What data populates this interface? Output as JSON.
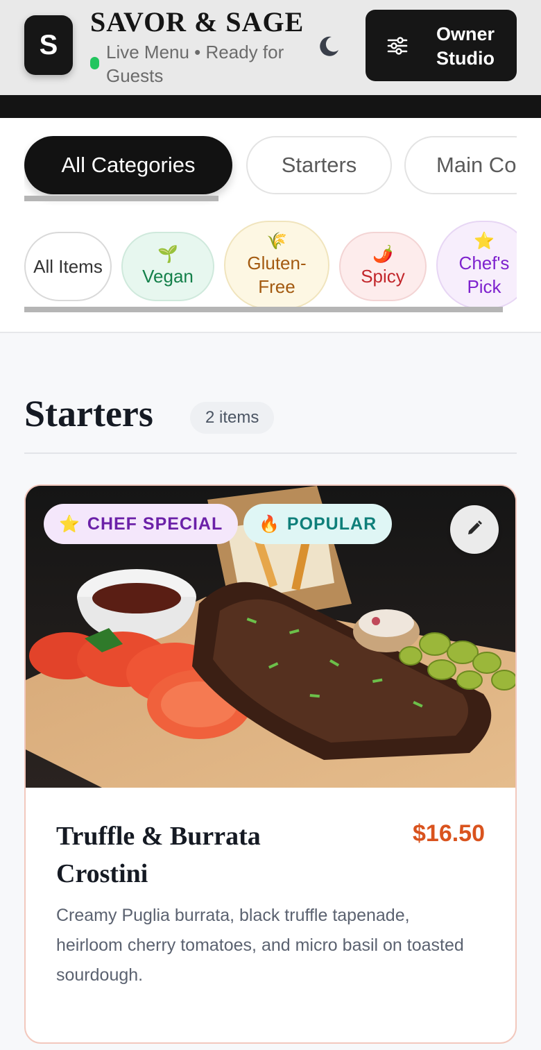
{
  "header": {
    "logo_letter": "S",
    "brand": "SAVOR & SAGE",
    "status_text": "Live Menu • Ready for Guests",
    "theme_icon": "moon-icon",
    "owner_button_label": "Owner Studio",
    "owner_button_icon": "sliders-icon"
  },
  "categories": [
    {
      "label": "All Categories",
      "active": true
    },
    {
      "label": "Starters",
      "active": false
    },
    {
      "label": "Main Co",
      "active": false
    }
  ],
  "diet_filters": [
    {
      "label": "All Items",
      "emoji": ""
    },
    {
      "label": "Vegan",
      "emoji": "🌱"
    },
    {
      "label": "Gluten-Free",
      "emoji": "🌾"
    },
    {
      "label": "Spicy",
      "emoji": "🌶️"
    },
    {
      "label": "Chef's Pick",
      "emoji": "⭐"
    }
  ],
  "section": {
    "title": "Starters",
    "count": "2 items"
  },
  "menu_items": [
    {
      "badges": [
        {
          "emoji": "⭐",
          "label": "CHEF SPECIAL"
        },
        {
          "emoji": "🔥",
          "label": "POPULAR"
        }
      ],
      "name": "Truffle & Burrata Crostini",
      "price": "$16.50",
      "description": "Creamy Puglia burrata, black truffle tapenade, heirloom cherry tomatoes, and micro basil on toasted sourdough.",
      "edit_icon": "pencil-icon"
    }
  ],
  "colors": {
    "accent_price": "#d9531e",
    "live_dot": "#22c55e",
    "vegan_bg": "#e7f7ef",
    "glutenfree_bg": "#fdf7e3",
    "spicy_bg": "#fdecec",
    "chefpick_bg": "#f7eefc"
  }
}
